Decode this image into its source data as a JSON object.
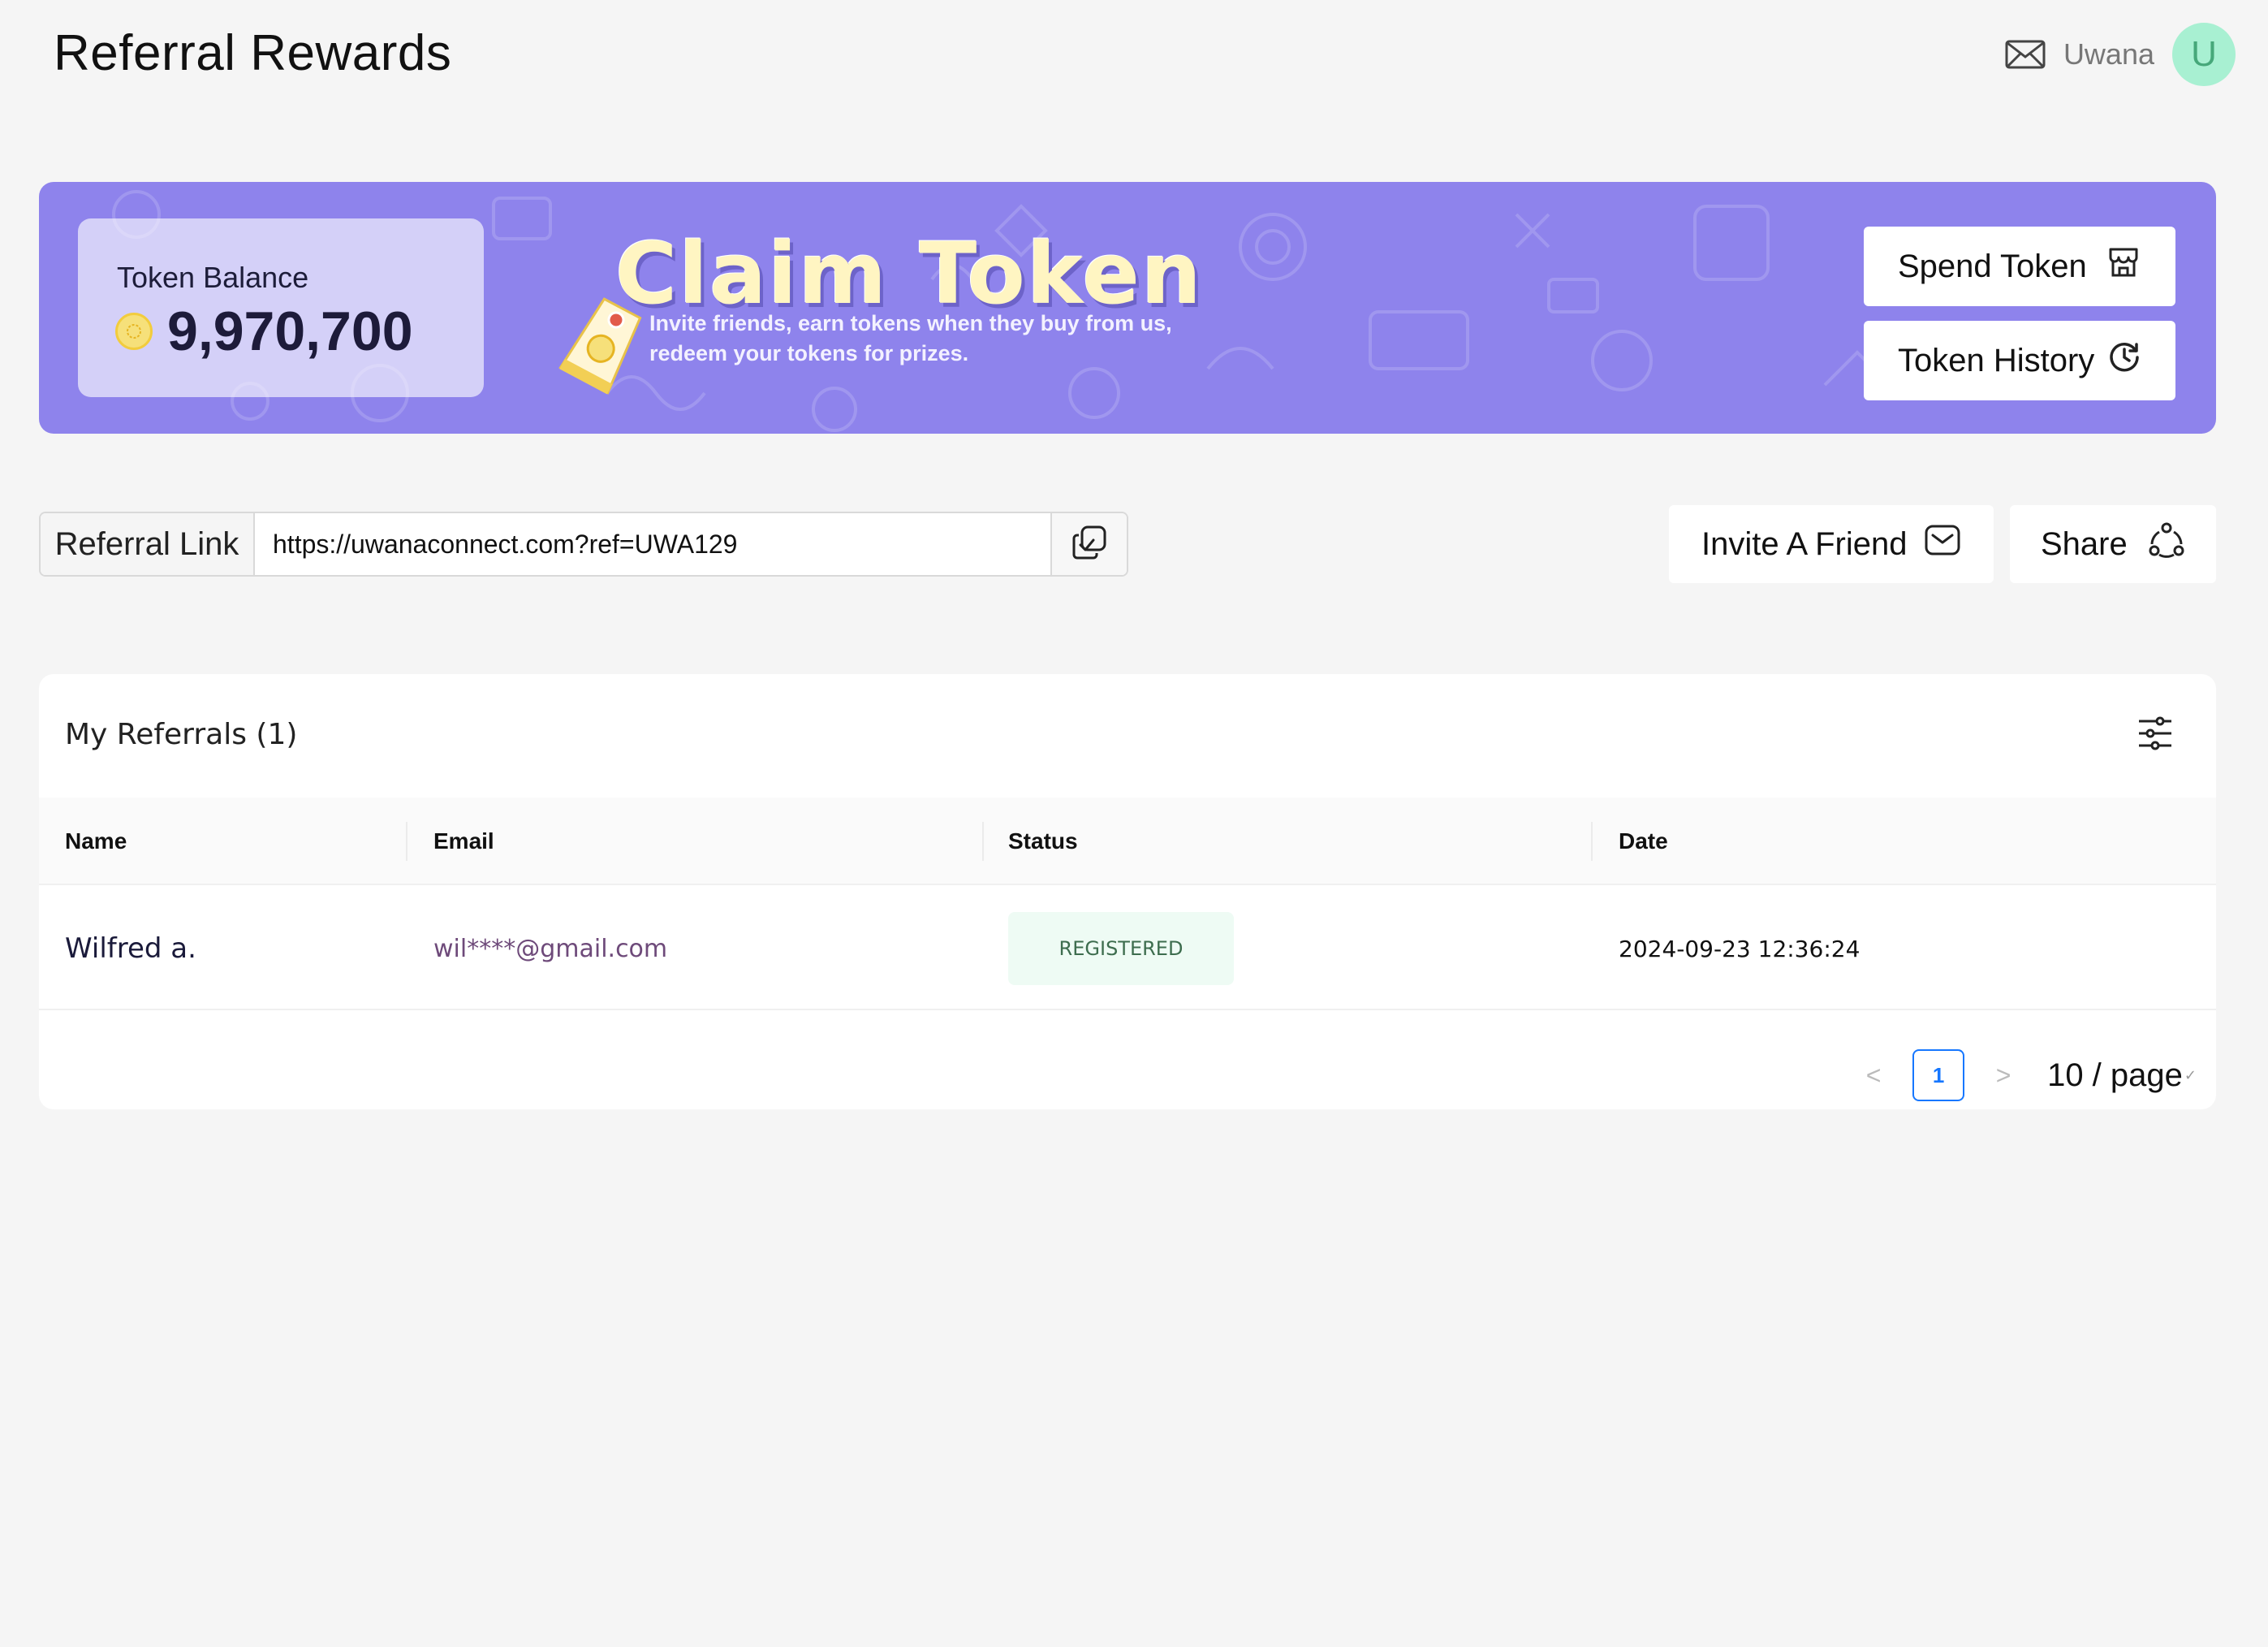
{
  "header": {
    "title": "Referral Rewards",
    "user_name": "Uwana",
    "avatar_letter": "U",
    "mail_icon": "mail-icon"
  },
  "banner": {
    "balance_label": "Token Balance",
    "balance_value": "9,970,700",
    "claim_title": "Claim Token",
    "claim_description": "Invite friends, earn tokens when they buy from us, redeem your tokens for prizes.",
    "spend_button": "Spend Token",
    "history_button": "Token History",
    "background_color": "#8e83ec"
  },
  "referral": {
    "label": "Referral Link",
    "link_value": "https://uwanaconnect.com?ref=UWA129",
    "invite_button": "Invite A Friend",
    "share_button": "Share"
  },
  "referrals_table": {
    "title": "My Referrals (1)",
    "columns": [
      "Name",
      "Email",
      "Status",
      "Date"
    ],
    "rows": [
      {
        "name": "Wilfred a.",
        "email": "wil****@gmail.com",
        "status": "REGISTERED",
        "date": "2024-09-23 12:36:24"
      }
    ]
  },
  "pagination": {
    "prev": "<",
    "current_page": "1",
    "next": ">",
    "page_size": "10 / page",
    "accent_color": "#1677ff"
  }
}
